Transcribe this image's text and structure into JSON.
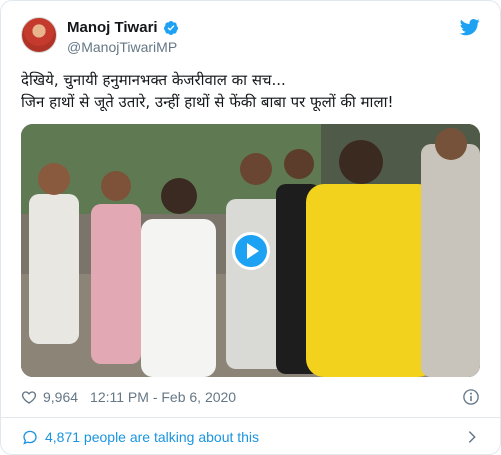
{
  "tweet": {
    "author": {
      "display_name": "Manoj Tiwari",
      "handle": "@ManojTiwariMP",
      "verified": true
    },
    "text_lines": [
      "देखिये, चुनायी हनुमानभक्त केजरीवाल का सच...",
      "जिन हाथों से जूते उतारे, उन्हीं हाथों से फेंकी बाबा पर फूलों की माला!"
    ],
    "media": {
      "type": "video",
      "play_icon": "play-icon"
    },
    "likes": "9,964",
    "timestamp": "12:11 PM - Feb 6, 2020",
    "conversation_text": "4,871 people are talking about this"
  },
  "icons": {
    "brand": "twitter-bird-icon",
    "verified": "verified-badge-icon",
    "like": "heart-icon",
    "info": "info-icon",
    "comment": "comment-icon",
    "chevron": "chevron-right-icon"
  },
  "colors": {
    "brand_blue": "#1da1f2",
    "link_blue": "#1b95e0",
    "secondary_text": "#657786",
    "border": "#e1e8ed"
  }
}
